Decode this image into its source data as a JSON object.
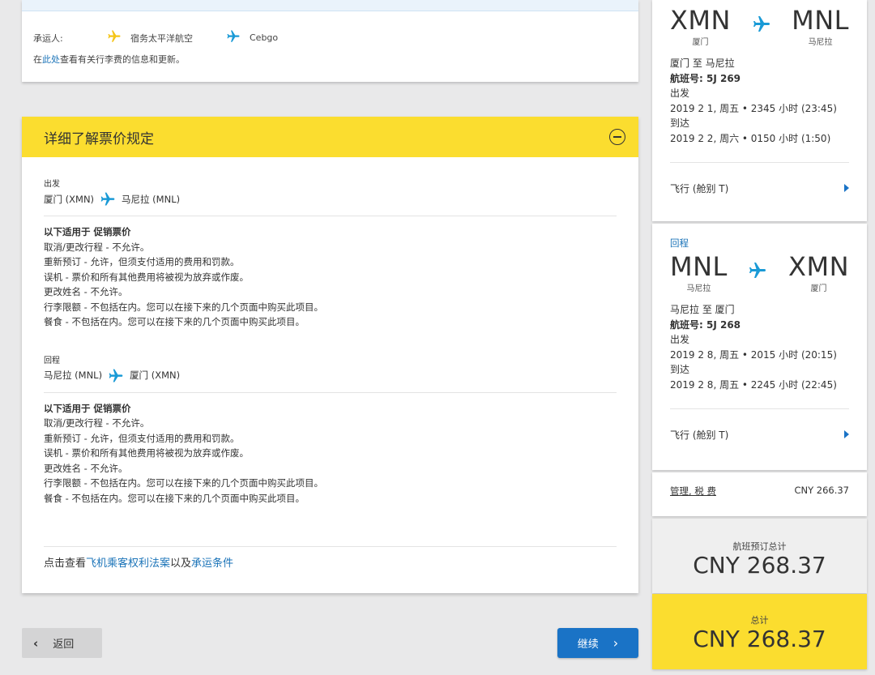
{
  "colors": {
    "accent_yellow": "#fbdd2f",
    "link_blue": "#1a73b8",
    "button_blue": "#1a73c6",
    "plane_yellow": "#f5c518",
    "plane_blue": "#1a9ad6"
  },
  "carrier": {
    "label": "承运人:",
    "carrier1": "宿务太平洋航空",
    "carrier2": "Cebgo",
    "note_prefix": "在",
    "note_link": "此处",
    "note_suffix": "查看有关行李费的信息和更新。"
  },
  "rules": {
    "title": "详细了解票价规定",
    "departure": {
      "label": "出发",
      "from": "厦门 (XMN)",
      "to": "马尼拉 (MNL)",
      "applies_prefix": "以下适用于 ",
      "fare_type": "促销票价",
      "lines": [
        "取消/更改行程 - 不允许。",
        "重新预订 - 允许，但须支付适用的费用和罚款。",
        "误机 - 票价和所有其他费用将被视为放弃或作废。",
        "更改姓名 - 不允许。",
        "行李限额 - 不包括在内。您可以在接下来的几个页面中购买此项目。",
        "餐食 - 不包括在内。您可以在接下来的几个页面中购买此项目。"
      ]
    },
    "return": {
      "label": "回程",
      "from": "马尼拉 (MNL)",
      "to": "厦门 (XMN)",
      "applies_prefix": "以下适用于 ",
      "fare_type": "促销票价",
      "lines": [
        "取消/更改行程 - 不允许。",
        "重新预订 - 允许，但须支付适用的费用和罚款。",
        "误机 - 票价和所有其他费用将被视为放弃或作废。",
        "更改姓名 - 不允许。",
        "行李限额 - 不包括在内。您可以在接下来的几个页面中购买此项目。",
        "餐食 - 不包括在内。您可以在接下来的几个页面中购买此项目。"
      ]
    },
    "footer_prefix": "点击查看",
    "footer_link1": "飞机乘客权利法案",
    "footer_mid": "以及",
    "footer_link2": "承运条件"
  },
  "buttons": {
    "back": "返回",
    "continue": "继续"
  },
  "summary": {
    "outbound": {
      "from_code": "XMN",
      "from_city": "厦门",
      "to_code": "MNL",
      "to_city": "马尼拉",
      "route": "厦门 至 马尼拉",
      "flight_label": "航班号: ",
      "flight_no": "5J 269",
      "depart_label": "出发",
      "depart_time": "2019 2 1, 周五 • 2345 小时 (23:45)",
      "arrive_label": "到达",
      "arrive_time": "2019 2 2, 周六 • 0150 小时 (1:50)",
      "fare_class": "飞行 (舱别 T)"
    },
    "return": {
      "label": "回程",
      "from_code": "MNL",
      "from_city": "马尼拉",
      "to_code": "XMN",
      "to_city": "厦门",
      "route": "马尼拉 至 厦门",
      "flight_label": "航班号: ",
      "flight_no": "5J 268",
      "depart_label": "出发",
      "depart_time": "2019 2 8, 周五 • 2015 小时 (20:15)",
      "arrive_label": "到达",
      "arrive_time": "2019 2 8, 周五 • 2245 小时 (22:45)",
      "fare_class": "飞行 (舱别 T)"
    },
    "fees_label": "管理, 税 费",
    "fees_value": "CNY 266.37",
    "booking_total_label": "航班预订总计",
    "booking_total_value": "CNY 268.37",
    "total_label": "总计",
    "total_value": "CNY 268.37"
  }
}
